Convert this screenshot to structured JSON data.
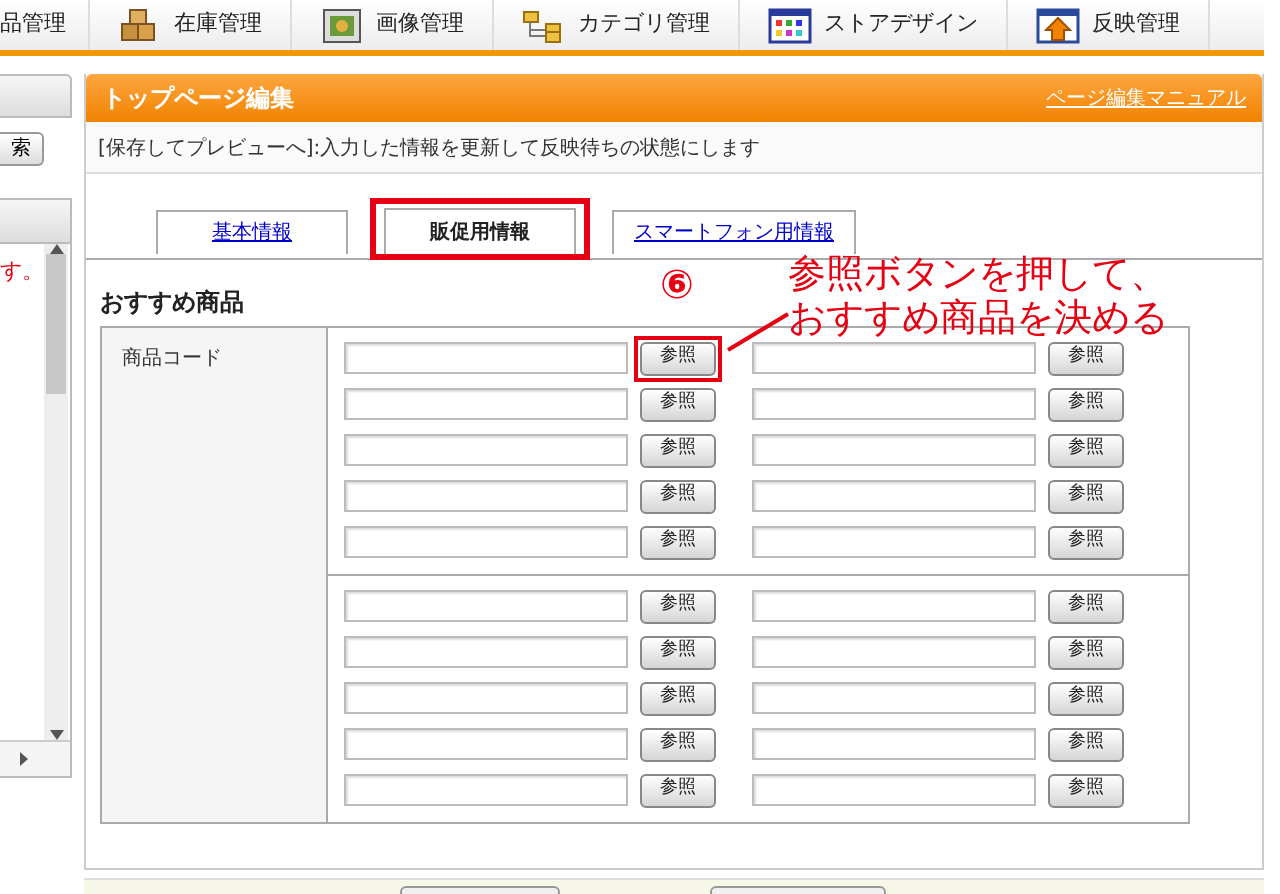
{
  "nav": {
    "items": [
      {
        "label": "品管理"
      },
      {
        "label": "在庫管理",
        "kind": "boxes"
      },
      {
        "label": "画像管理",
        "kind": "image"
      },
      {
        "label": "カテゴリ管理",
        "kind": "folders"
      },
      {
        "label": "ストアデザイン",
        "kind": "palette"
      },
      {
        "label": "反映管理",
        "kind": "upload"
      }
    ]
  },
  "sidebar": {
    "search_button": "索",
    "notice": "す。"
  },
  "panel": {
    "title": "トップページ編集",
    "manual_link": "ページ編集マニュアル",
    "description": "[保存してプレビューへ]:入力した情報を更新して反映待ちの状態にします",
    "tabs": [
      {
        "label": "基本情報",
        "selected": false,
        "highlighted": false
      },
      {
        "label": "販促用情報",
        "selected": true,
        "highlighted": true
      },
      {
        "label": "スマートフォン用情報",
        "selected": false,
        "highlighted": false
      }
    ],
    "section_title": "おすすめ商品",
    "field_label": "商品コード",
    "groups": [
      [
        {
          "button_1": "参照",
          "button_1_highlighted": true,
          "button_2": "参照"
        },
        {
          "button_1": "参照",
          "button_1_highlighted": false,
          "button_2": "参照"
        },
        {
          "button_1": "参照",
          "button_1_highlighted": false,
          "button_2": "参照"
        },
        {
          "button_1": "参照",
          "button_1_highlighted": false,
          "button_2": "参照"
        },
        {
          "button_1": "参照",
          "button_1_highlighted": false,
          "button_2": "参照"
        }
      ],
      [
        {
          "button_1": "参照",
          "button_1_highlighted": false,
          "button_2": "参照"
        },
        {
          "button_1": "参照",
          "button_1_highlighted": false,
          "button_2": "参照"
        },
        {
          "button_1": "参照",
          "button_1_highlighted": false,
          "button_2": "参照"
        },
        {
          "button_1": "参照",
          "button_1_highlighted": false,
          "button_2": "参照"
        },
        {
          "button_1": "参照",
          "button_1_highlighted": false,
          "button_2": "参照"
        }
      ]
    ]
  },
  "callout": {
    "number": "⑥",
    "lines": [
      "参照ボタンを押して、",
      "おすすめ商品を決める"
    ]
  }
}
